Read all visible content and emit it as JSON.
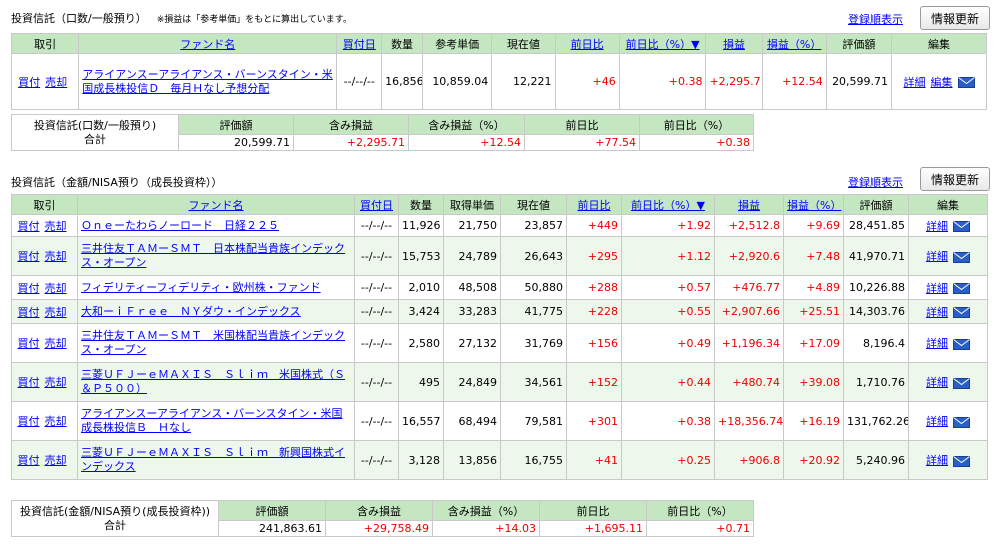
{
  "section1": {
    "title": "投資信託（口数/一般預り）",
    "note": "※損益は「参考単価」をもとに算出しています。",
    "order_link": "登録順表示",
    "refresh_label": "情報更新",
    "headers": [
      "取引",
      "ファンド名",
      "買付日",
      "数量",
      "参考単価",
      "現在値",
      "前日比",
      "前日比（%）▼",
      "損益",
      "損益（%）",
      "評価額",
      "編集"
    ],
    "rows": [
      {
        "buy": "買付",
        "sell": "売却",
        "fund": "アライアンスーアライアンス・バーンスタイン・米国成長株投信Ｄ　毎月Ｈなし予想分配",
        "date": "--/--/--",
        "qty": "16,856",
        "unit": "10,859.04",
        "price": "12,221",
        "change": "+46",
        "change_pct": "+0.38",
        "pl": "+2,295.71",
        "pl_pct": "+12.54",
        "value": "20,599.71",
        "detail": "詳細",
        "edit": "編集"
      }
    ],
    "summary": {
      "label": "投資信託(口数/一般預り)",
      "total_label": "合計",
      "headers": [
        "評価額",
        "含み損益",
        "含み損益（%）",
        "前日比",
        "前日比（%）"
      ],
      "values": [
        "20,599.71",
        "+2,295.71",
        "+12.54",
        "+77.54",
        "+0.38"
      ]
    }
  },
  "section2": {
    "title": "投資信託（金額/NISA預り（成長投資枠））",
    "order_link": "登録順表示",
    "refresh_label": "情報更新",
    "headers": [
      "取引",
      "ファンド名",
      "買付日",
      "数量",
      "取得単価",
      "現在値",
      "前日比",
      "前日比（%）▼",
      "損益",
      "損益（%）",
      "評価額",
      "編集"
    ],
    "rows": [
      {
        "buy": "買付",
        "sell": "売却",
        "fund": "Ｏｎｅーたわらノーロード　日経２２５",
        "date": "--/--/--",
        "qty": "11,926",
        "unit": "21,750",
        "price": "23,857",
        "change": "+449",
        "change_pct": "+1.92",
        "pl": "+2,512.8",
        "pl_pct": "+9.69",
        "value": "28,451.85",
        "detail": "詳細"
      },
      {
        "buy": "買付",
        "sell": "売却",
        "fund": "三井住友ＴＡＭーＳＭＴ　日本株配当貴族インデックス・オープン",
        "date": "--/--/--",
        "qty": "15,753",
        "unit": "24,789",
        "price": "26,643",
        "change": "+295",
        "change_pct": "+1.12",
        "pl": "+2,920.6",
        "pl_pct": "+7.48",
        "value": "41,970.71",
        "detail": "詳細"
      },
      {
        "buy": "買付",
        "sell": "売却",
        "fund": "フィデリティーフィデリティ・欧州株・ファンド",
        "date": "--/--/--",
        "qty": "2,010",
        "unit": "48,508",
        "price": "50,880",
        "change": "+288",
        "change_pct": "+0.57",
        "pl": "+476.77",
        "pl_pct": "+4.89",
        "value": "10,226.88",
        "detail": "詳細"
      },
      {
        "buy": "買付",
        "sell": "売却",
        "fund": "大和ーｉＦｒｅｅ　ＮＹダウ・インデックス",
        "date": "--/--/--",
        "qty": "3,424",
        "unit": "33,283",
        "price": "41,775",
        "change": "+228",
        "change_pct": "+0.55",
        "pl": "+2,907.66",
        "pl_pct": "+25.51",
        "value": "14,303.76",
        "detail": "詳細"
      },
      {
        "buy": "買付",
        "sell": "売却",
        "fund": "三井住友ＴＡＭーＳＭＴ　米国株配当貴族インデックス・オープン",
        "date": "--/--/--",
        "qty": "2,580",
        "unit": "27,132",
        "price": "31,769",
        "change": "+156",
        "change_pct": "+0.49",
        "pl": "+1,196.34",
        "pl_pct": "+17.09",
        "value": "8,196.4",
        "detail": "詳細"
      },
      {
        "buy": "買付",
        "sell": "売却",
        "fund": "三菱ＵＦＪーｅＭＡＸＩＳ　Ｓｌｉｍ　米国株式（Ｓ＆Ｐ５００）",
        "date": "--/--/--",
        "qty": "495",
        "unit": "24,849",
        "price": "34,561",
        "change": "+152",
        "change_pct": "+0.44",
        "pl": "+480.74",
        "pl_pct": "+39.08",
        "value": "1,710.76",
        "detail": "詳細"
      },
      {
        "buy": "買付",
        "sell": "売却",
        "fund": "アライアンスーアライアンス・バーンスタイン・米国成長株投信Ｂ　Ｈなし",
        "date": "--/--/--",
        "qty": "16,557",
        "unit": "68,494",
        "price": "79,581",
        "change": "+301",
        "change_pct": "+0.38",
        "pl": "+18,356.74",
        "pl_pct": "+16.19",
        "value": "131,762.26",
        "detail": "詳細"
      },
      {
        "buy": "買付",
        "sell": "売却",
        "fund": "三菱ＵＦＪーｅＭＡＸＩＳ　Ｓｌｉｍ　新興国株式インデックス",
        "date": "--/--/--",
        "qty": "3,128",
        "unit": "13,856",
        "price": "16,755",
        "change": "+41",
        "change_pct": "+0.25",
        "pl": "+906.8",
        "pl_pct": "+20.92",
        "value": "5,240.96",
        "detail": "詳細"
      }
    ],
    "summary": {
      "label": "投資信託(金額/NISA預り(成長投資枠))",
      "total_label": "合計",
      "headers": [
        "評価額",
        "含み損益",
        "含み損益（%）",
        "前日比",
        "前日比（%）"
      ],
      "values": [
        "241,863.61",
        "+29,758.49",
        "+14.03",
        "+1,695.11",
        "+0.71"
      ]
    }
  }
}
